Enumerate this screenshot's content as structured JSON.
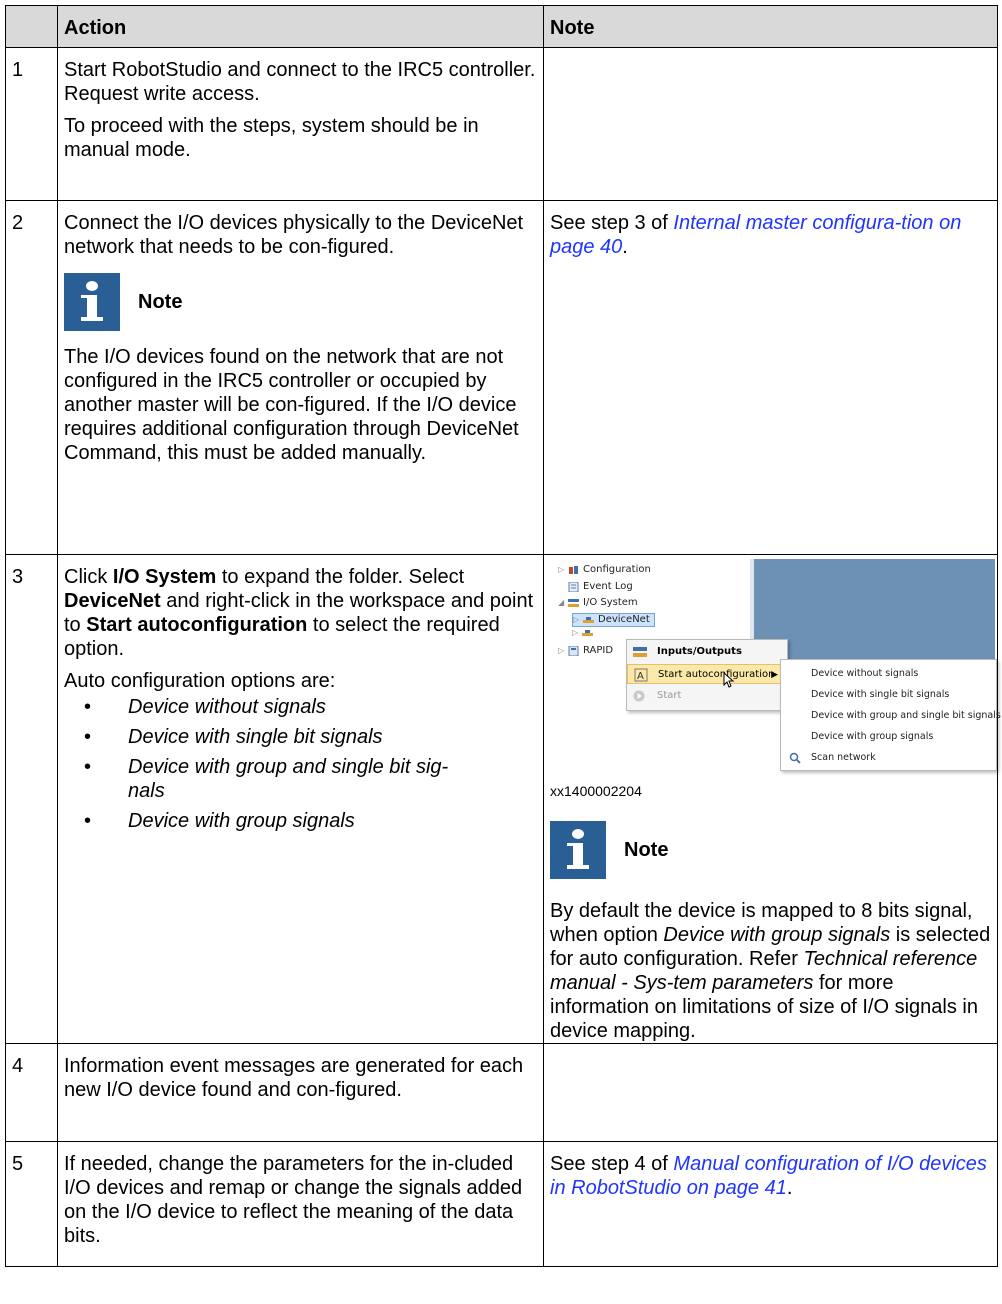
{
  "table": {
    "headers": [
      "",
      "Action",
      "Note"
    ],
    "rows": [
      {
        "num": "1",
        "action_p1": "Start RobotStudio and connect to the IRC5 controller. Request write access.",
        "action_p2": "To proceed with the steps, system should be in manual mode.",
        "note": ""
      },
      {
        "num": "2",
        "action_p1": "Connect the I/O devices physically to the DeviceNet network that needs to be con-figured.",
        "note_label": "Note",
        "action_p2": "The I/O devices found on the network that are not configured in the IRC5 controller or occupied by another master will be con-figured. If the I/O device requires additional configuration through DeviceNet Command, this must be added manually.",
        "note_prefix": "See step 3 of ",
        "note_link": "Internal master configura-tion on page 40",
        "note_suffix": "."
      },
      {
        "num": "3",
        "action_a": "Click ",
        "action_b": "I/O System",
        "action_c": " to expand the folder. Select ",
        "action_d": "DeviceNet",
        "action_e": " and right-click in the workspace and point to ",
        "action_f": "Start autoconfiguration",
        "action_g": " to select the required option.",
        "options_heading": "Auto configuration options are:",
        "options": [
          "Device without signals",
          "Device with single bit signals",
          "Device with group and single bit sig-nals",
          "Device with group signals"
        ],
        "figure": {
          "tree": [
            "Configuration",
            "Event Log",
            "I/O System",
            "DeviceNet",
            "RAPID"
          ],
          "menu1": [
            "Inputs/Outputs",
            "Start autoconfiguration",
            "Start"
          ],
          "menu2": [
            "Device without signals",
            "Device with single bit signals",
            "Device with group and single bit signals",
            "Device with group signals",
            "Scan network"
          ],
          "caption": "xx1400002204"
        },
        "note_label": "Note",
        "note_a": "By default the device is mapped to 8 bits signal, when option ",
        "note_b": "Device with group signals",
        "note_c": " is selected for auto configuration. Refer ",
        "note_d": "Technical reference manual - Sys-tem parameters",
        "note_e": " for more information on limitations of size of I/O signals in device mapping."
      },
      {
        "num": "4",
        "action_p1": "Information event messages are generated for each new I/O device found and con-figured.",
        "note": ""
      },
      {
        "num": "5",
        "action_p1": "If needed, change the parameters for the in-cluded I/O devices and remap or change the signals added on the I/O device to reflect the meaning of the data bits.",
        "note_prefix": "See step 4 of ",
        "note_link": "Manual configuration of I/O devices in RobotStudio on page 41",
        "note_suffix": "."
      }
    ]
  },
  "colors": {
    "header_bg": "#d9d9d9",
    "link": "#1f35ff",
    "note_icon": "#2a5f95"
  },
  "icons": [
    "info-icon"
  ]
}
